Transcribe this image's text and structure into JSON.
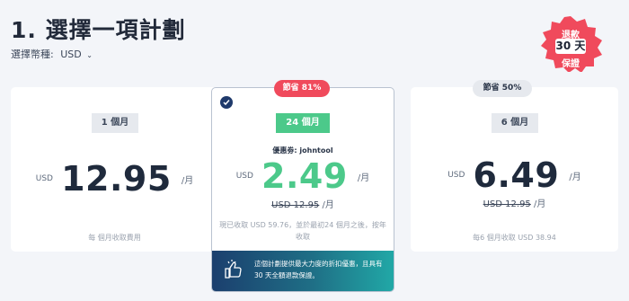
{
  "header": {
    "title": "1. 選擇一項計劃",
    "currency_label": "選擇幣種:",
    "currency_value": "USD"
  },
  "guarantee": {
    "top": "退款",
    "mid": "30 天",
    "bottom": "保證"
  },
  "plans": [
    {
      "ribbon": "1 個月",
      "currency": "USD",
      "price": "12.95",
      "per": "/月",
      "note": "每 個月收取費用"
    },
    {
      "save_badge": "節省 81%",
      "ribbon": "24 個月",
      "coupon": "優惠劵: johntool",
      "currency": "USD",
      "price": "2.49",
      "per": "/月",
      "strike_price": "USD 12.95",
      "strike_per": "/月",
      "note": "現已收取 USD 59.76，並於最初24 個月之後，按年收取",
      "promo": "這個計劃提供最大力度的折扣優惠，且具有 30 天全額退款保證。"
    },
    {
      "save_badge": "節省 50%",
      "ribbon": "6 個月",
      "currency": "USD",
      "price": "6.49",
      "per": "/月",
      "strike_price": "USD 12.95",
      "strike_per": "/月",
      "note": "每6 個月收取 USD 38.94"
    }
  ],
  "colors": {
    "accent_green": "#4cc98a",
    "badge_red": "#f04a5c",
    "navy": "#1f3a6b"
  }
}
